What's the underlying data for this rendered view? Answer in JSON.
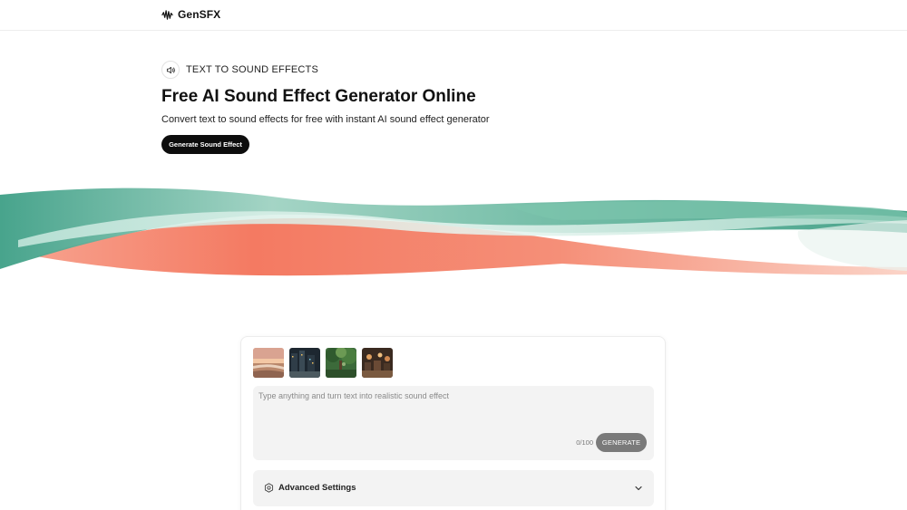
{
  "brand": {
    "name": "GenSFX",
    "icon": "waveform-icon"
  },
  "hero": {
    "badge_icon": "speaker-icon",
    "badge_label": "TEXT TO SOUND EFFECTS",
    "title": "Free AI Sound Effect Generator Online",
    "subtitle": "Convert text to sound effects for free with instant AI sound effect generator",
    "cta_label": "Generate Sound Effect"
  },
  "colors": {
    "accent_dark": "#0d0d0d",
    "wave_teal": "#5fb39a",
    "wave_coral": "#f47a62",
    "panel_bg": "#f3f3f3",
    "generate_button": "#7a7a7a"
  },
  "generator": {
    "presets": [
      {
        "name": "beach-sunset"
      },
      {
        "name": "city-night"
      },
      {
        "name": "forest"
      },
      {
        "name": "banquet"
      }
    ],
    "prompt_placeholder": "Type anything and turn text into realistic sound effect",
    "prompt_value": "",
    "char_count": "0/100",
    "generate_label": "GENERATE",
    "advanced_icon": "settings-icon",
    "advanced_label": "Advanced Settings",
    "advanced_chevron": "chevron-down-icon"
  }
}
